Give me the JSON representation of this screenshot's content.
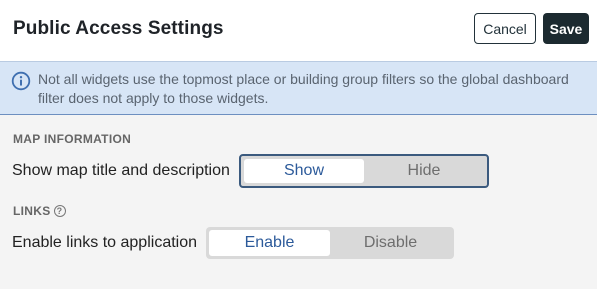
{
  "header": {
    "title": "Public Access Settings",
    "cancel_label": "Cancel",
    "save_label": "Save"
  },
  "banner": {
    "icon": "info-icon",
    "text": "Not all widgets use the topmost place or building group filters so the global dashboard filter does not apply to those widgets."
  },
  "map_section": {
    "heading": "MAP INFORMATION",
    "row_label": "Show map title and description",
    "options": [
      "Show",
      "Hide"
    ],
    "selected": "Show"
  },
  "links_section": {
    "heading": "LINKS",
    "help_icon": "help-icon",
    "help_glyph": "?",
    "row_label": "Enable links to application",
    "options": [
      "Enable",
      "Disable"
    ],
    "selected": "Enable"
  },
  "colors": {
    "save_button": "#1c2a30",
    "banner_bg": "#d7e5f6",
    "active_text": "#2c5a9a"
  }
}
